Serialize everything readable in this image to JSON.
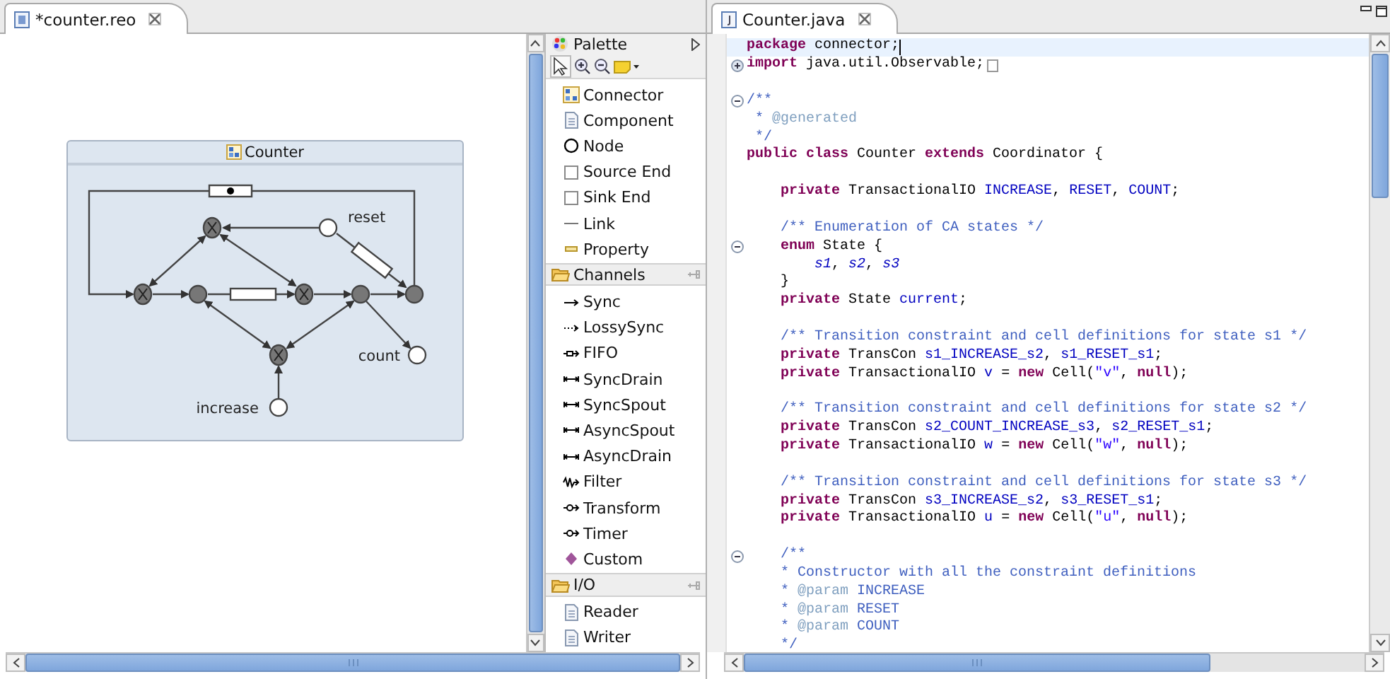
{
  "diagram_editor": {
    "tab": {
      "title": "*counter.reo",
      "selected": true
    },
    "connector": {
      "title": "Counter",
      "labels": [
        {
          "kind": "reset",
          "text": "reset"
        },
        {
          "kind": "count",
          "text": "count"
        },
        {
          "kind": "increase",
          "text": "increase"
        }
      ]
    }
  },
  "palette": {
    "title": "Palette",
    "drawers": [
      {
        "items": [
          {
            "label": "Connector",
            "kind": "connector"
          },
          {
            "label": "Component",
            "kind": "component"
          },
          {
            "label": "Node",
            "kind": "node"
          },
          {
            "label": "Source End",
            "kind": "source"
          },
          {
            "label": "Sink End",
            "kind": "sink"
          },
          {
            "label": "Link",
            "kind": "link"
          },
          {
            "label": "Property",
            "kind": "property"
          }
        ]
      },
      {
        "title": "Channels",
        "items": [
          {
            "label": "Sync",
            "kind": "sync"
          },
          {
            "label": "LossySync",
            "kind": "lossy"
          },
          {
            "label": "FIFO",
            "kind": "fifo"
          },
          {
            "label": "SyncDrain",
            "kind": "syncdrain"
          },
          {
            "label": "SyncSpout",
            "kind": "syncspout"
          },
          {
            "label": "AsyncSpout",
            "kind": "asyncspout"
          },
          {
            "label": "AsyncDrain",
            "kind": "asyncdrain"
          },
          {
            "label": "Filter",
            "kind": "filter"
          },
          {
            "label": "Transform",
            "kind": "transform"
          },
          {
            "label": "Timer",
            "kind": "timer"
          },
          {
            "label": "Custom",
            "kind": "custom"
          }
        ]
      },
      {
        "title": "I/O",
        "items": [
          {
            "label": "Reader",
            "kind": "reader"
          },
          {
            "label": "Writer",
            "kind": "writer"
          }
        ]
      }
    ]
  },
  "code_editor": {
    "tab": {
      "title": "Counter.java",
      "selected": true
    },
    "lines": [
      {
        "kind": "line",
        "current": true,
        "tokens": [
          {
            "kind": "kw",
            "t": "package"
          },
          {
            "kind": "plain",
            "t": " connector;"
          }
        ]
      },
      {
        "kind": "folded",
        "current": false,
        "tokens": [
          {
            "kind": "kw",
            "t": "import"
          },
          {
            "kind": "plain",
            "t": " java.util.Observable;"
          }
        ]
      },
      {
        "kind": "blank",
        "current": false
      },
      {
        "kind": "foldable",
        "current": false,
        "tokens": [
          {
            "kind": "doc",
            "t": "/**"
          }
        ]
      },
      {
        "kind": "line",
        "current": false,
        "tokens": [
          {
            "kind": "doc",
            "t": " * "
          },
          {
            "kind": "tag",
            "t": "@generated"
          }
        ]
      },
      {
        "kind": "line",
        "current": false,
        "tokens": [
          {
            "kind": "doc",
            "t": " */"
          }
        ]
      },
      {
        "kind": "line",
        "current": false,
        "tokens": [
          {
            "kind": "kw",
            "t": "public class"
          },
          {
            "kind": "plain",
            "t": " Counter "
          },
          {
            "kind": "kw",
            "t": "extends"
          },
          {
            "kind": "plain",
            "t": " Coordinator {"
          }
        ]
      },
      {
        "kind": "blank",
        "current": false
      },
      {
        "kind": "line",
        "current": false,
        "tokens": [
          {
            "kind": "kw",
            "t": "    private"
          },
          {
            "kind": "plain",
            "t": " TransactionalIO "
          },
          {
            "kind": "field",
            "t": "INCREASE"
          },
          {
            "kind": "plain",
            "t": ", "
          },
          {
            "kind": "field",
            "t": "RESET"
          },
          {
            "kind": "plain",
            "t": ", "
          },
          {
            "kind": "field",
            "t": "COUNT"
          },
          {
            "kind": "plain",
            "t": ";"
          }
        ]
      },
      {
        "kind": "blank",
        "current": false
      },
      {
        "kind": "line",
        "current": false,
        "tokens": [
          {
            "kind": "doc",
            "t": "    /** Enumeration of CA states */"
          }
        ]
      },
      {
        "kind": "foldable",
        "current": false,
        "tokens": [
          {
            "kind": "kw",
            "t": "    enum"
          },
          {
            "kind": "plain",
            "t": " State {"
          }
        ]
      },
      {
        "kind": "line",
        "current": false,
        "tokens": [
          {
            "kind": "static",
            "t": "        s1"
          },
          {
            "kind": "plain",
            "t": ", "
          },
          {
            "kind": "static",
            "t": "s2"
          },
          {
            "kind": "plain",
            "t": ", "
          },
          {
            "kind": "static",
            "t": "s3"
          }
        ]
      },
      {
        "kind": "line",
        "current": false,
        "tokens": [
          {
            "kind": "plain",
            "t": "    }"
          }
        ]
      },
      {
        "kind": "line",
        "current": false,
        "tokens": [
          {
            "kind": "kw",
            "t": "    private"
          },
          {
            "kind": "plain",
            "t": " State "
          },
          {
            "kind": "field",
            "t": "current"
          },
          {
            "kind": "plain",
            "t": ";"
          }
        ]
      },
      {
        "kind": "blank",
        "current": false
      },
      {
        "kind": "line",
        "current": false,
        "tokens": [
          {
            "kind": "doc",
            "t": "    /** Transition constraint and cell definitions for state s1 */"
          }
        ]
      },
      {
        "kind": "line",
        "current": false,
        "tokens": [
          {
            "kind": "kw",
            "t": "    private"
          },
          {
            "kind": "plain",
            "t": " TransCon "
          },
          {
            "kind": "field",
            "t": "s1_INCREASE_s2"
          },
          {
            "kind": "plain",
            "t": ", "
          },
          {
            "kind": "field",
            "t": "s1_RESET_s1"
          },
          {
            "kind": "plain",
            "t": ";"
          }
        ]
      },
      {
        "kind": "line",
        "current": false,
        "tokens": [
          {
            "kind": "kw",
            "t": "    private"
          },
          {
            "kind": "plain",
            "t": " TransactionalIO "
          },
          {
            "kind": "field",
            "t": "v"
          },
          {
            "kind": "plain",
            "t": " = "
          },
          {
            "kind": "kw",
            "t": "new"
          },
          {
            "kind": "plain",
            "t": " Cell("
          },
          {
            "kind": "str",
            "t": "\"v\""
          },
          {
            "kind": "plain",
            "t": ", "
          },
          {
            "kind": "kw",
            "t": "null"
          },
          {
            "kind": "plain",
            "t": ");"
          }
        ]
      },
      {
        "kind": "blank",
        "current": false
      },
      {
        "kind": "line",
        "current": false,
        "tokens": [
          {
            "kind": "doc",
            "t": "    /** Transition constraint and cell definitions for state s2 */"
          }
        ]
      },
      {
        "kind": "line",
        "current": false,
        "tokens": [
          {
            "kind": "kw",
            "t": "    private"
          },
          {
            "kind": "plain",
            "t": " TransCon "
          },
          {
            "kind": "field",
            "t": "s2_COUNT_INCREASE_s3"
          },
          {
            "kind": "plain",
            "t": ", "
          },
          {
            "kind": "field",
            "t": "s2_RESET_s1"
          },
          {
            "kind": "plain",
            "t": ";"
          }
        ]
      },
      {
        "kind": "line",
        "current": false,
        "tokens": [
          {
            "kind": "kw",
            "t": "    private"
          },
          {
            "kind": "plain",
            "t": " TransactionalIO "
          },
          {
            "kind": "field",
            "t": "w"
          },
          {
            "kind": "plain",
            "t": " = "
          },
          {
            "kind": "kw",
            "t": "new"
          },
          {
            "kind": "plain",
            "t": " Cell("
          },
          {
            "kind": "str",
            "t": "\"w\""
          },
          {
            "kind": "plain",
            "t": ", "
          },
          {
            "kind": "kw",
            "t": "null"
          },
          {
            "kind": "plain",
            "t": ");"
          }
        ]
      },
      {
        "kind": "blank",
        "current": false
      },
      {
        "kind": "line",
        "current": false,
        "tokens": [
          {
            "kind": "doc",
            "t": "    /** Transition constraint and cell definitions for state s3 */"
          }
        ]
      },
      {
        "kind": "line",
        "current": false,
        "tokens": [
          {
            "kind": "kw",
            "t": "    private"
          },
          {
            "kind": "plain",
            "t": " TransCon "
          },
          {
            "kind": "field",
            "t": "s3_INCREASE_s2"
          },
          {
            "kind": "plain",
            "t": ", "
          },
          {
            "kind": "field",
            "t": "s3_RESET_s1"
          },
          {
            "kind": "plain",
            "t": ";"
          }
        ]
      },
      {
        "kind": "line",
        "current": false,
        "tokens": [
          {
            "kind": "kw",
            "t": "    private"
          },
          {
            "kind": "plain",
            "t": " TransactionalIO "
          },
          {
            "kind": "field",
            "t": "u"
          },
          {
            "kind": "plain",
            "t": " = "
          },
          {
            "kind": "kw",
            "t": "new"
          },
          {
            "kind": "plain",
            "t": " Cell("
          },
          {
            "kind": "str",
            "t": "\"u\""
          },
          {
            "kind": "plain",
            "t": ", "
          },
          {
            "kind": "kw",
            "t": "null"
          },
          {
            "kind": "plain",
            "t": ");"
          }
        ]
      },
      {
        "kind": "blank",
        "current": false
      },
      {
        "kind": "foldable",
        "current": false,
        "tokens": [
          {
            "kind": "doc",
            "t": "    /**"
          }
        ]
      },
      {
        "kind": "line",
        "current": false,
        "tokens": [
          {
            "kind": "doc",
            "t": "    * Constructor with all the constraint definitions"
          }
        ]
      },
      {
        "kind": "line",
        "current": false,
        "tokens": [
          {
            "kind": "doc",
            "t": "    * "
          },
          {
            "kind": "tag",
            "t": "@param"
          },
          {
            "kind": "doc",
            "t": " INCREASE"
          }
        ]
      },
      {
        "kind": "line",
        "current": false,
        "tokens": [
          {
            "kind": "doc",
            "t": "    * "
          },
          {
            "kind": "tag",
            "t": "@param"
          },
          {
            "kind": "doc",
            "t": " RESET"
          }
        ]
      },
      {
        "kind": "line",
        "current": false,
        "tokens": [
          {
            "kind": "doc",
            "t": "    * "
          },
          {
            "kind": "tag",
            "t": "@param"
          },
          {
            "kind": "doc",
            "t": " COUNT"
          }
        ]
      },
      {
        "kind": "line",
        "current": false,
        "tokens": [
          {
            "kind": "doc",
            "t": "    */"
          }
        ]
      }
    ]
  }
}
